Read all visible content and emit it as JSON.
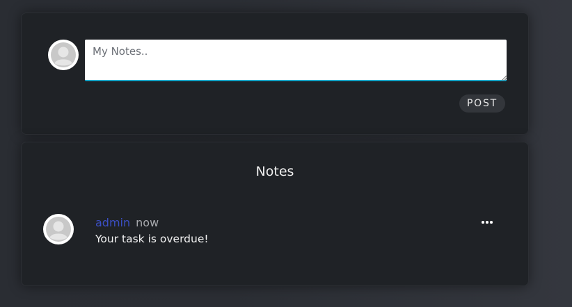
{
  "compose": {
    "placeholder": "My Notes..",
    "value": "",
    "post_label": "POST",
    "avatar_icon": "user-avatar-icon"
  },
  "notes": {
    "title": "Notes",
    "items": [
      {
        "author": "admin",
        "time": "now",
        "text": "Your task is overdue!",
        "avatar_icon": "user-avatar-icon",
        "menu_icon": "more-horizontal-icon"
      }
    ]
  },
  "colors": {
    "background": "#2b2e34",
    "card": "#1f2226",
    "accent_input_underline": "#1aa7c9",
    "author_link": "#3b4fc4",
    "button_bg": "#33363b"
  }
}
